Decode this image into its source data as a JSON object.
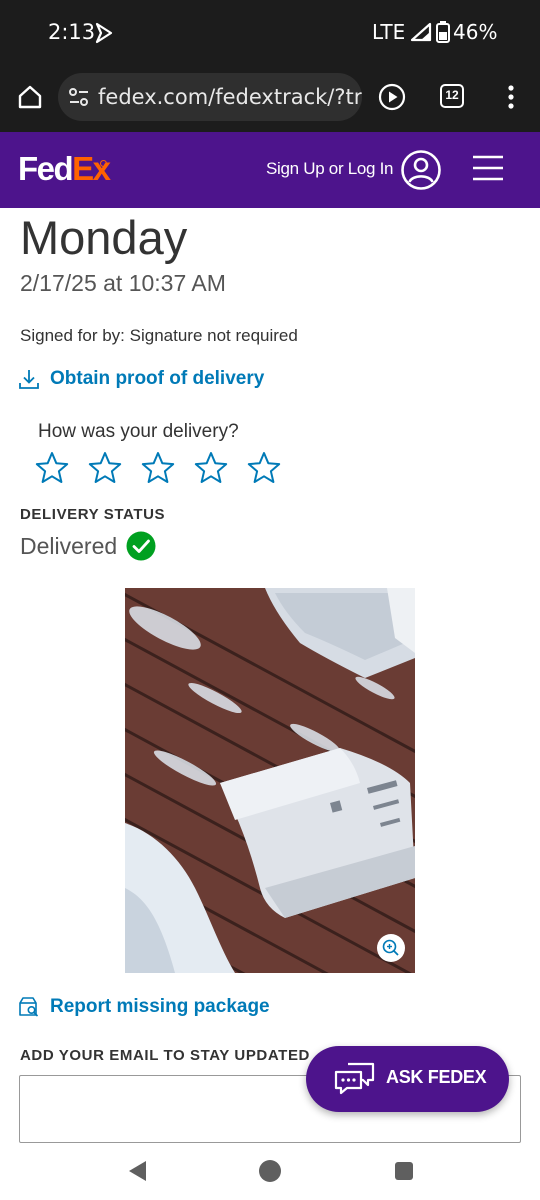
{
  "status_bar": {
    "time": "2:13",
    "network": "LTE",
    "battery": "46%"
  },
  "browser": {
    "url": "fedex.com/fedextrack/?trknbr",
    "tab_count": "12"
  },
  "header": {
    "logo_fed": "Fed",
    "logo_ex": "Ex",
    "sign_in": "Sign Up or Log In"
  },
  "delivery": {
    "day": "Monday",
    "datetime": "2/17/25 at 10:37 AM",
    "signed_for": "Signed for by: Signature not required",
    "proof_link": "Obtain proof of delivery"
  },
  "rating": {
    "question": "How was your delivery?",
    "max_stars": 5,
    "selected_stars": 0
  },
  "status": {
    "heading": "DELIVERY STATUS",
    "value": "Delivered"
  },
  "actions": {
    "report_link": "Report missing package",
    "email_heading": "ADD YOUR EMAIL TO STAY UPDATED",
    "email_placeholder": ""
  },
  "chat": {
    "label": "ASK FEDEX"
  },
  "colors": {
    "fedex_purple": "#4d148c",
    "fedex_orange": "#ff6200",
    "link_blue": "#007ab7",
    "success_green": "#00a020"
  }
}
